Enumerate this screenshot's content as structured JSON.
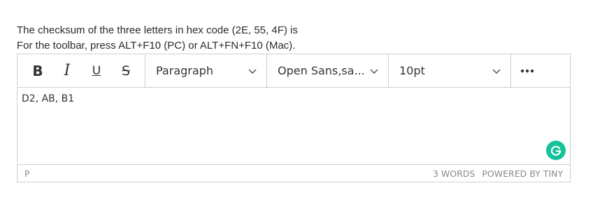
{
  "question": {
    "line1": "The checksum of the three letters in hex code (2E, 55, 4F) is",
    "line2": "For the toolbar, press ALT+F10 (PC) or ALT+FN+F10 (Mac)."
  },
  "toolbar": {
    "bold_label": "B",
    "italic_label": "I",
    "underline_label": "U",
    "strike_label": "S",
    "block_format": "Paragraph",
    "font_family": "Open Sans,sa...",
    "font_size": "10pt",
    "more_icon": "ellipsis-icon"
  },
  "editor": {
    "content": "D2, AB, B1",
    "grammarly_icon": "grammarly-icon",
    "grammarly_color": "#15c39a"
  },
  "statusbar": {
    "path": "P",
    "word_count": "3 WORDS",
    "branding": "POWERED BY TINY"
  }
}
